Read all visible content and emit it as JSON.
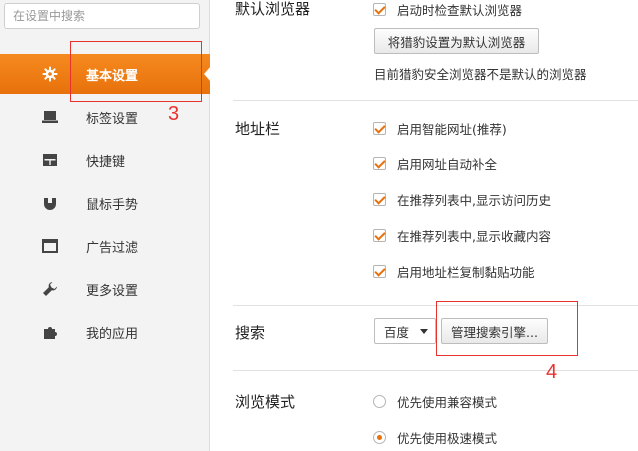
{
  "sidebar": {
    "search_placeholder": "在设置中搜索",
    "items": [
      {
        "label": "基本设置",
        "icon": "gear-icon"
      },
      {
        "label": "标签设置",
        "icon": "laptop-icon"
      },
      {
        "label": "快捷键",
        "icon": "keyboard-icon"
      },
      {
        "label": "鼠标手势",
        "icon": "mouse-icon"
      },
      {
        "label": "广告过滤",
        "icon": "window-icon"
      },
      {
        "label": "更多设置",
        "icon": "wrench-icon"
      },
      {
        "label": "我的应用",
        "icon": "puzzle-icon"
      }
    ]
  },
  "default_browser": {
    "title": "默认浏览器",
    "check_on_start": "启动时检查默认浏览器",
    "set_default_button": "将猎豹设置为默认浏览器",
    "status": "目前猎豹安全浏览器不是默认的浏览器"
  },
  "address_bar": {
    "title": "地址栏",
    "options": [
      "启用智能网址(推荐)",
      "启用网址自动补全",
      "在推荐列表中,显示访问历史",
      "在推荐列表中,显示收藏内容",
      "启用地址栏复制黏贴功能"
    ]
  },
  "search": {
    "title": "搜索",
    "engine": "百度",
    "manage_button": "管理搜索引擎..."
  },
  "browse_mode": {
    "title": "浏览模式",
    "options": [
      "优先使用兼容模式",
      "优先使用极速模式"
    ]
  },
  "annotations": {
    "label_3": "3",
    "label_4": "4"
  },
  "colors": {
    "accent": "#e8710b",
    "annotation": "#e8322e"
  }
}
